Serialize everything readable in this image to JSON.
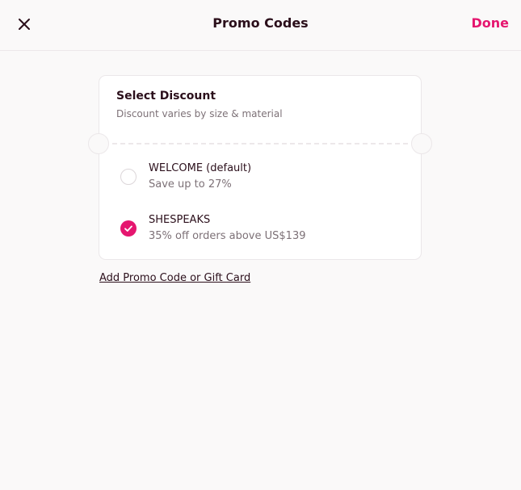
{
  "header": {
    "title": "Promo Codes",
    "done_label": "Done",
    "close_icon": "close-icon"
  },
  "colors": {
    "accent": "#e5166f",
    "text_dark": "#2b0f1b",
    "text_muted": "#7d7177",
    "background": "#faf9f9"
  },
  "card": {
    "title": "Select Discount",
    "subtitle": "Discount varies by size & material",
    "options": [
      {
        "name": "WELCOME (default)",
        "description": "Save up to 27%",
        "selected": false
      },
      {
        "name": "SHESPEAKS",
        "description": "35% off orders above US$139",
        "selected": true
      }
    ]
  },
  "add_link": "Add Promo Code or Gift Card"
}
